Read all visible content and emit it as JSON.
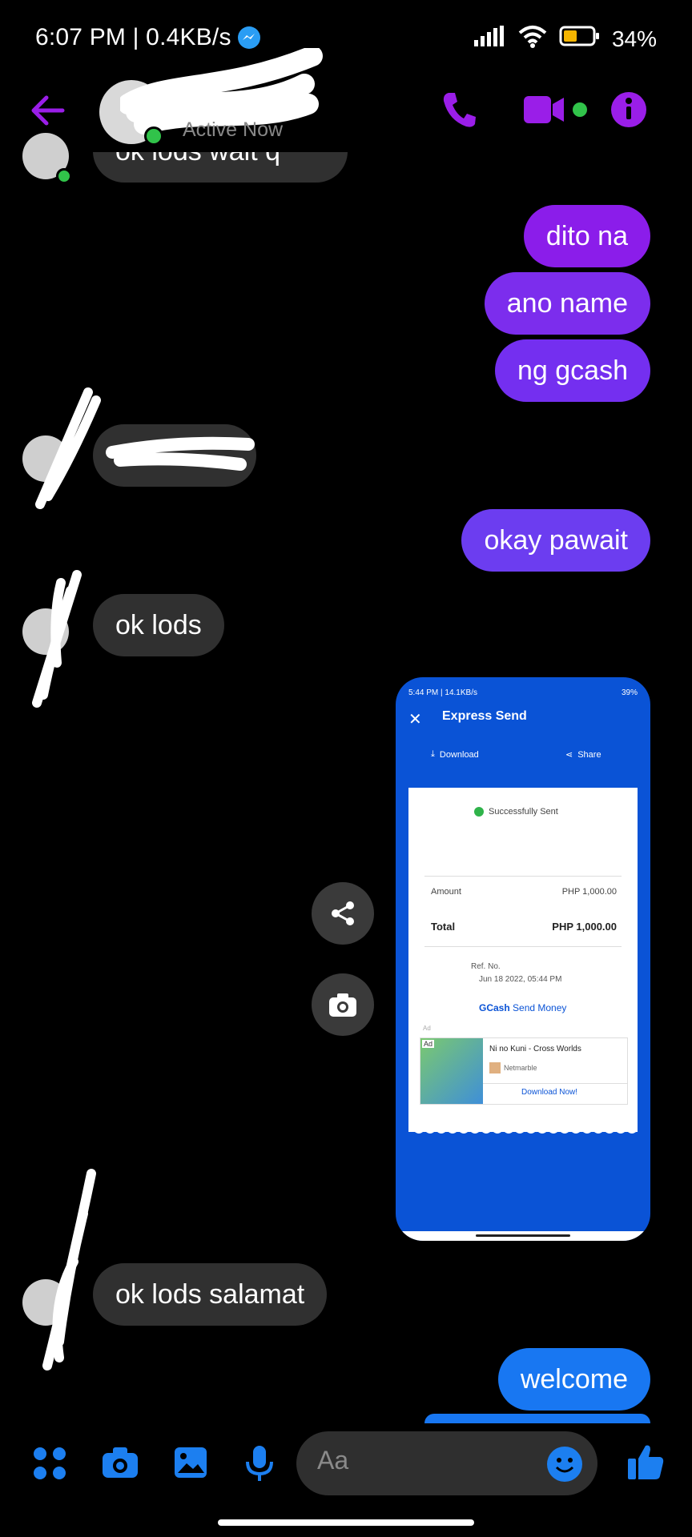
{
  "status_bar": {
    "time_speed": "6:07 PM | 0.4KB/s",
    "battery": "34%"
  },
  "header": {
    "status_text": "Active Now"
  },
  "messages": {
    "partial_top": "ok lods wait q",
    "out1": "dito na",
    "out2": "ano name",
    "out3": "ng gcash",
    "out4": "okay pawait",
    "in2": "ok lods",
    "in3": "ok lods salamat",
    "out5": "welcome"
  },
  "attachment": {
    "status_bar": "5:44 PM | 14.1KB/s",
    "status_battery": "39%",
    "title": "Express Send",
    "download_label": "Download",
    "share_label": "Share",
    "success_label": "Successfully Sent",
    "amount_label": "Amount",
    "amount_value": "PHP 1,000.00",
    "total_label": "Total",
    "total_value": "PHP 1,000.00",
    "ref_label": "Ref. No.",
    "datetime": "Jun 18 2022, 05:44 PM",
    "brand": "GCash",
    "brand_suffix": "Send Money",
    "ad_small": "Ad",
    "ad_badge": "Ad",
    "ad_title": "Ni no Kuni - Cross Worlds",
    "ad_publisher": "Netmarble",
    "ad_cta": "Download Now!"
  },
  "composer": {
    "placeholder": "Aa"
  },
  "colors": {
    "purple": "#8b1dea",
    "violet": "#6c3df0",
    "blue": "#1877f2",
    "accent_icons": "#9a1ee8",
    "composer_icons": "#1c7ff0"
  }
}
